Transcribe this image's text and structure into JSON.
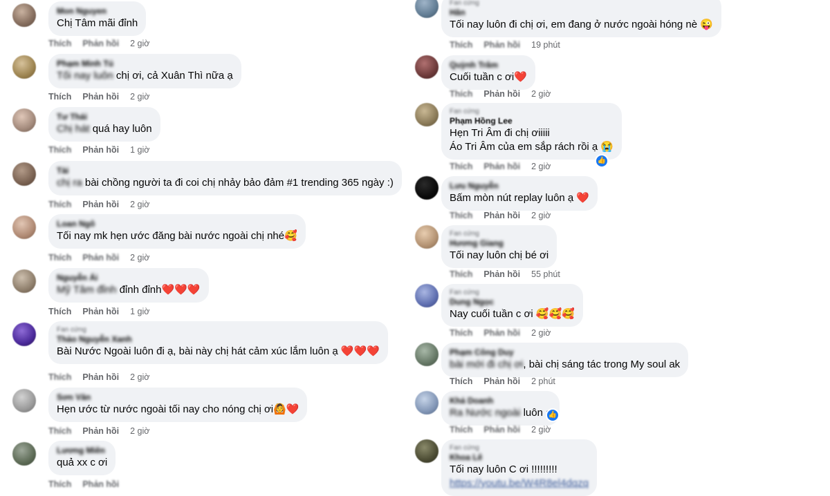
{
  "left": [
    {
      "name": "Mon Nguyen",
      "text_blur": "",
      "text": "Chị Tâm mãi đỉnh",
      "like": "Thích",
      "reply": "Phản hồi",
      "time": "2 giờ"
    },
    {
      "name": "Phạm Minh Tú",
      "text_blur": "Tối nay luôn",
      "text": " chị ơi, cả Xuân Thì nữa ạ",
      "like": "Thích",
      "reply": "Phản hồi",
      "time": "2 giờ"
    },
    {
      "name": "Tư Thái",
      "text_blur": "Chị hát",
      "text": " quá hay luôn",
      "like": "Thích",
      "reply": "Phản hồi",
      "time": "1 giờ"
    },
    {
      "name": "Tài",
      "text_blur": "chị ra",
      "text": " bài chồng người ta đi coi chị nhảy bảo đảm #1 trending 365 ngày :)",
      "like": "Thích",
      "reply": "Phản hồi",
      "time": "2 giờ"
    },
    {
      "name": "Loan Ngô",
      "text_blur": "",
      "text": "Tối nay mk hẹn ước đăng bài nước ngoài chị nhé🥰",
      "like": "Thích",
      "reply": "Phản hồi",
      "time": "2 giờ"
    },
    {
      "name": "Nguyễn Ái",
      "text_blur": "Mỹ Tâm đỉnh",
      "text": " đỉnh đỉnh❤️❤️❤️",
      "like": "Thích",
      "reply": "Phản hồi",
      "time": "1 giờ"
    },
    {
      "fan": "Fan cứng",
      "name": "Thảo Nguyễn Xanh",
      "text_blur": "",
      "text": "Bài Nước Ngoài luôn đi ạ, bài này chị hát cảm xúc lắm luôn ạ ❤️❤️❤️",
      "like": "Thích",
      "reply": "Phản hồi",
      "time": "2 giờ"
    },
    {
      "name": "Sơn Văn",
      "text_blur": "",
      "text": "Hẹn ước từ nước ngoài tối nay cho nóng chị ơi🙆❤️",
      "like": "Thích",
      "reply": "Phản hồi",
      "time": "2 giờ"
    },
    {
      "name": "Lương Miên",
      "text_blur": "",
      "text": "quả xx c ơi",
      "like": "Thích",
      "reply": "Phản hồi",
      "time": ""
    }
  ],
  "right": [
    {
      "fan": "Fan cứng",
      "name": "Hân",
      "text_blur": "",
      "text": "Tối nay luôn đi chị ơi, em đang ở nước ngoài hóng nè 😜",
      "like": "Thích",
      "reply": "Phản hồi",
      "time": "19 phút"
    },
    {
      "name": "Quỳnh Trâm",
      "text_blur": "",
      "text": "Cuối tuần c ơi❤️",
      "like": "Thích",
      "reply": "Phản hồi",
      "time": "2 giờ"
    },
    {
      "fan": "Fan cứng",
      "name": "Phạm Hồng Lee",
      "text_blur": "",
      "text": "Hẹn Tri Âm đi chị ơiiiii",
      "text2": "Áo Tri Âm của em sắp rách rồi ạ 😭",
      "like": "Thích",
      "reply": "Phản hồi",
      "time": "2 giờ"
    },
    {
      "name": "Lưu Nguyễn",
      "text_blur": "",
      "text": "Bấm mòn nút replay luôn ạ ❤️",
      "like": "Thích",
      "reply": "Phản hồi",
      "time": "2 giờ"
    },
    {
      "fan": "Fan cứng",
      "name": "Hương Giang",
      "text_blur": "",
      "text": "Tối nay luôn chị bé ơi",
      "like": "Thích",
      "reply": "Phản hồi",
      "time": "55 phút"
    },
    {
      "fan": "Fan cứng",
      "name": "Dung Ngọc",
      "text_blur": "",
      "text": "Nay cuối tuần c ơi 🥰🥰🥰",
      "like": "Thích",
      "reply": "Phản hồi",
      "time": "2 giờ"
    },
    {
      "name": "Phạm Công Duy",
      "text_blur": "bài mới đi chị ơi",
      "text": ", bài chị sáng tác trong My soul ak",
      "like": "Thích",
      "reply": "Phản hồi",
      "time": "2 phút"
    },
    {
      "name": "Khả Doanh",
      "text_blur": "Ra Nước ngoài",
      "text": " luôn ạ",
      "like": "Thích",
      "reply": "Phản hồi",
      "time": "2 giờ"
    },
    {
      "fan": "Fan cứng",
      "name": "Khoa Lê",
      "text_blur": "",
      "text": "Tối nay luôn C ơi !!!!!!!!!",
      "text2": "https://youtu.be/W4R8el4dqzq",
      "like": "Thích",
      "reply": "Phản hồi",
      "time": ""
    }
  ]
}
